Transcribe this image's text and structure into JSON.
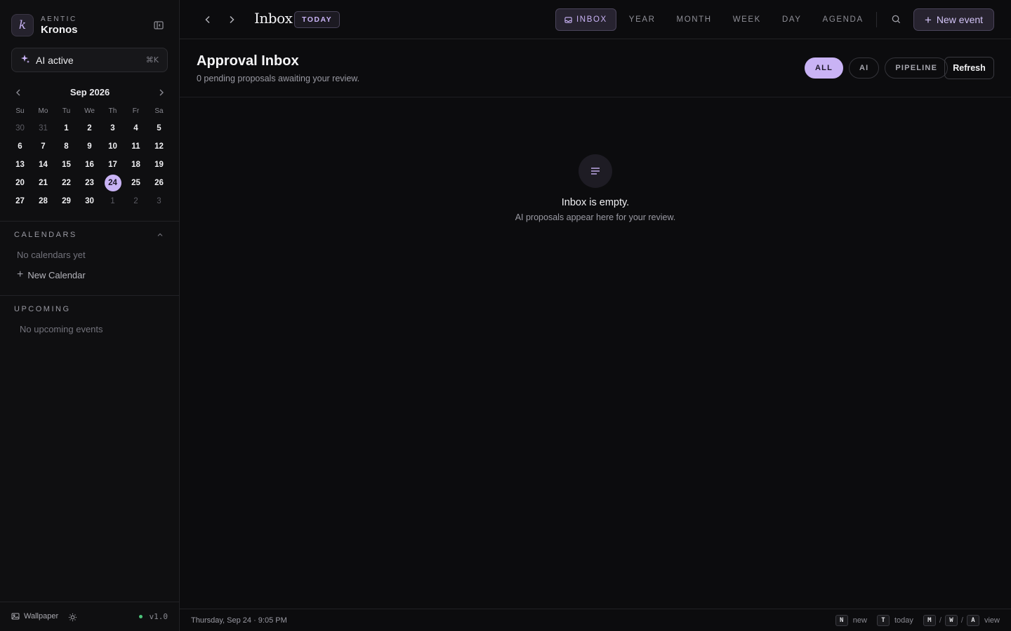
{
  "brand": {
    "top": "AENTIC",
    "name": "Kronos",
    "logo_letter": "k"
  },
  "ai_status": {
    "label": "AI active",
    "shortcut": "⌘K"
  },
  "mini_calendar": {
    "title": "Sep 2026",
    "weekdays": [
      "Su",
      "Mo",
      "Tu",
      "We",
      "Th",
      "Fr",
      "Sa"
    ],
    "days": [
      {
        "d": "30",
        "muted": true
      },
      {
        "d": "31",
        "muted": true
      },
      {
        "d": "1"
      },
      {
        "d": "2"
      },
      {
        "d": "3"
      },
      {
        "d": "4"
      },
      {
        "d": "5"
      },
      {
        "d": "6"
      },
      {
        "d": "7"
      },
      {
        "d": "8"
      },
      {
        "d": "9"
      },
      {
        "d": "10"
      },
      {
        "d": "11"
      },
      {
        "d": "12"
      },
      {
        "d": "13"
      },
      {
        "d": "14"
      },
      {
        "d": "15"
      },
      {
        "d": "16"
      },
      {
        "d": "17"
      },
      {
        "d": "18"
      },
      {
        "d": "19"
      },
      {
        "d": "20"
      },
      {
        "d": "21"
      },
      {
        "d": "22"
      },
      {
        "d": "23"
      },
      {
        "d": "24",
        "today": true
      },
      {
        "d": "25"
      },
      {
        "d": "26"
      },
      {
        "d": "27"
      },
      {
        "d": "28"
      },
      {
        "d": "29"
      },
      {
        "d": "30"
      },
      {
        "d": "1",
        "muted": true
      },
      {
        "d": "2",
        "muted": true
      },
      {
        "d": "3",
        "muted": true
      }
    ]
  },
  "calendars": {
    "title": "CALENDARS",
    "empty": "No calendars yet",
    "new_label": "New Calendar"
  },
  "upcoming": {
    "title": "UPCOMING",
    "empty": "No upcoming events"
  },
  "sidebar_footer": {
    "wallpaper": "Wallpaper",
    "version": "v1.0"
  },
  "topbar": {
    "title": "Inbox",
    "today": "TODAY",
    "views": [
      "INBOX",
      "YEAR",
      "MONTH",
      "WEEK",
      "DAY",
      "AGENDA"
    ],
    "active_view": "INBOX",
    "new_event": "New event"
  },
  "page": {
    "title": "Approval Inbox",
    "subtitle": "0 pending proposals awaiting your review.",
    "filters": [
      "ALL",
      "AI",
      "PIPELINE"
    ],
    "active_filter": "ALL",
    "refresh": "Refresh"
  },
  "empty_state": {
    "title": "Inbox is empty.",
    "subtitle": "AI proposals appear here for your review."
  },
  "statusbar": {
    "datetime": "Thursday, Sep 24 · 9:05 PM",
    "shortcuts": {
      "n_key": "N",
      "n_label": "new",
      "t_key": "T",
      "t_label": "today",
      "m_key": "M",
      "w_key": "W",
      "a_key": "A",
      "view_label": "view"
    }
  },
  "colors": {
    "accent": "#c9b3f5",
    "background": "#0c0c0e",
    "sidebar": "#0f0f11",
    "status_dot": "#4cc47a"
  },
  "icons": {
    "collapse": "sidebar-collapse-icon",
    "sparkle": "sparkle-icon",
    "prev": "chevron-left-icon",
    "next": "chevron-right-icon",
    "inbox": "inbox-icon",
    "search": "search-icon",
    "empty": "list-lines-icon",
    "wallpaper": "image-icon",
    "theme": "sun-icon"
  }
}
